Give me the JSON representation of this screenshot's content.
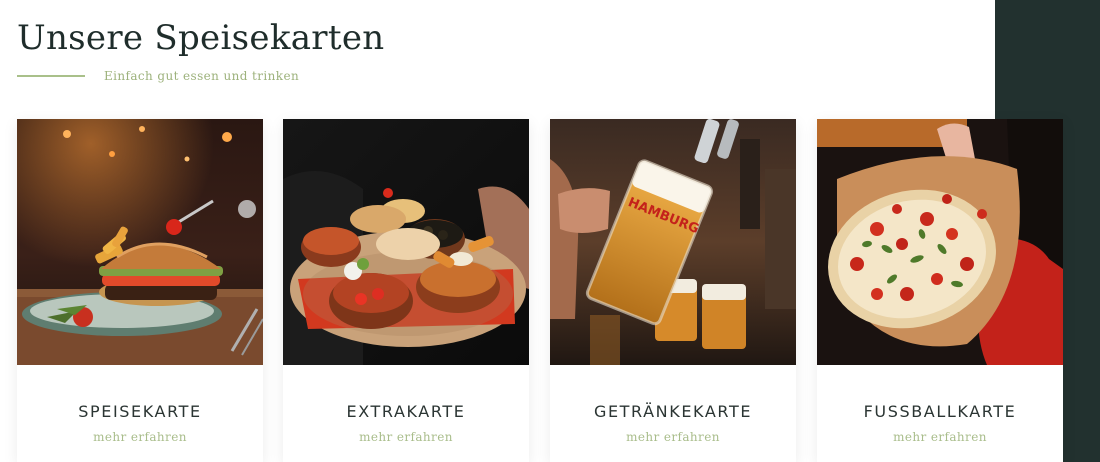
{
  "header": {
    "title": "Unsere Speisekarten",
    "subtitle": "Einfach gut essen und trinken"
  },
  "colors": {
    "accent_green": "#a9c08a",
    "dark_panel": "#22312f",
    "title_text": "#1f2d2b"
  },
  "cards": [
    {
      "title": "SPEISEKARTE",
      "link": "mehr erfahren",
      "image": "burger-photo"
    },
    {
      "title": "EXTRAKARTE",
      "link": "mehr erfahren",
      "image": "tapas-photo"
    },
    {
      "title": "GETRÄNKEKARTE",
      "link": "mehr erfahren",
      "image": "beer-tap-photo",
      "glass_logo": "HAMBURG"
    },
    {
      "title": "FUSSBALLKARTE",
      "link": "mehr erfahren",
      "image": "flatbread-photo"
    }
  ]
}
